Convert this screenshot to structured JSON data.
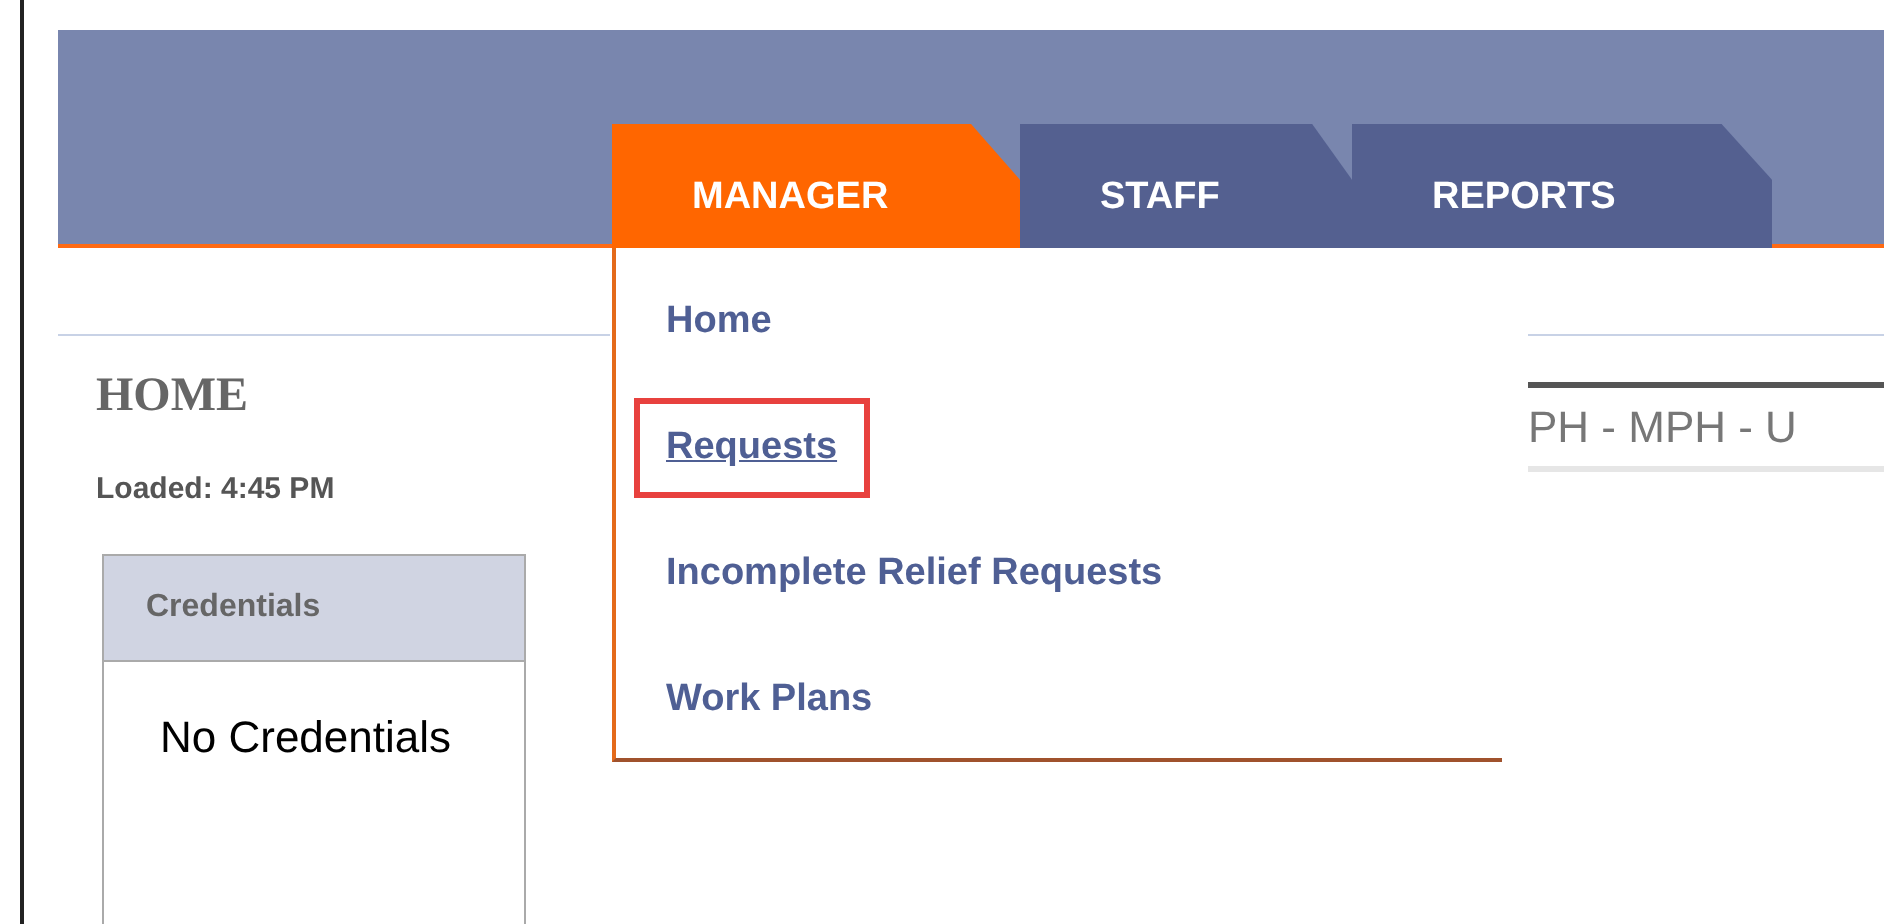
{
  "tabs": [
    {
      "label": "MANAGER",
      "selected": true
    },
    {
      "label": "STAFF",
      "selected": false
    },
    {
      "label": "REPORTS",
      "selected": false
    }
  ],
  "menu": {
    "items": [
      {
        "label": "Home",
        "highlighted": false
      },
      {
        "label": "Requests",
        "highlighted": true
      },
      {
        "label": "Incomplete Relief Requests",
        "highlighted": false
      },
      {
        "label": "Work Plans",
        "highlighted": false
      }
    ]
  },
  "page": {
    "title": "HOME",
    "loaded": "Loaded: 4:45 PM",
    "credentials_panel": {
      "title": "Credentials",
      "body": "No Credentials"
    },
    "location": "PH - MPH - U"
  }
}
